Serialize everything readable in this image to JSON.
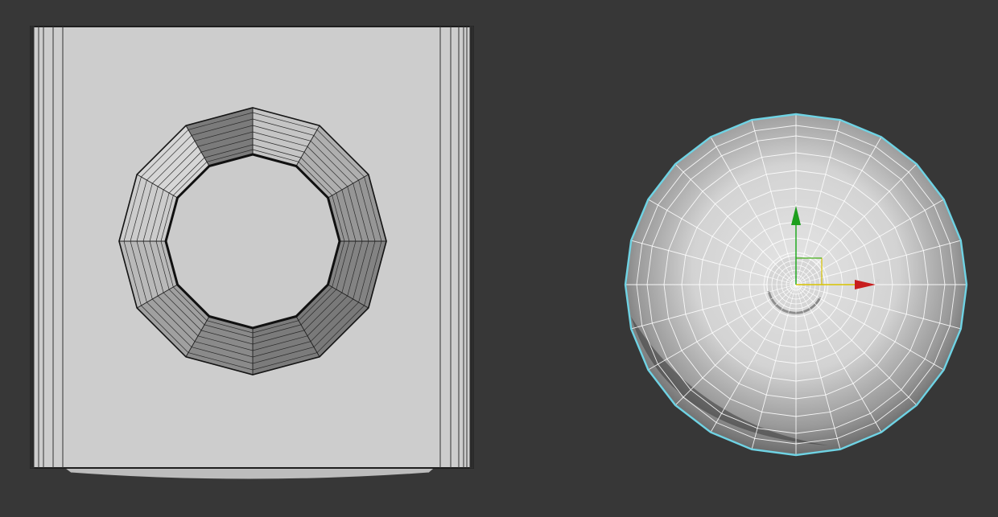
{
  "viewport": {
    "background": "#373737",
    "objects": [
      {
        "name": "panel-with-hole",
        "kind": "box-with-ring-hole",
        "color": "#cdcdcd"
      },
      {
        "name": "dome",
        "kind": "hemisphere",
        "selected": true,
        "selection_color": "#6fd3e4"
      }
    ]
  },
  "gizmo": {
    "x_label": "x",
    "y_label": "y",
    "x_color": "#cc2222",
    "y_color": "#22aa22",
    "plane_color": "#d8c300"
  }
}
